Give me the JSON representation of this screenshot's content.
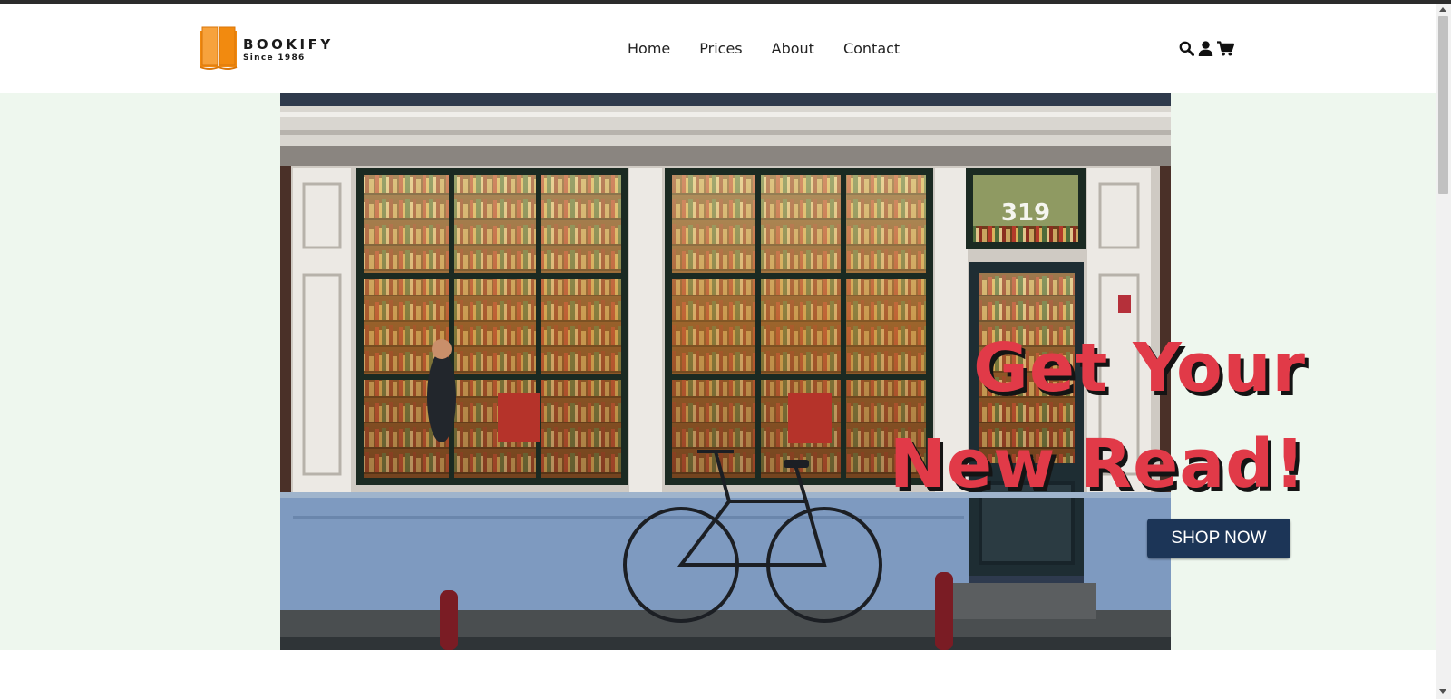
{
  "brand": {
    "name": "BOOKIFY",
    "tagline": "Since 1986",
    "logo_color": "#f28a0f"
  },
  "nav": {
    "links": [
      "Home",
      "Prices",
      "About",
      "Contact"
    ],
    "icons": [
      "search-icon",
      "user-icon",
      "cart-icon"
    ]
  },
  "hero": {
    "title_line1": "Get Your",
    "title_line2": "New Read!",
    "cta_label": "SHOP NOW",
    "storefront_number": "319",
    "title_color": "#e13a48",
    "cta_color": "#1c3557",
    "background_color": "#eef7ee"
  }
}
